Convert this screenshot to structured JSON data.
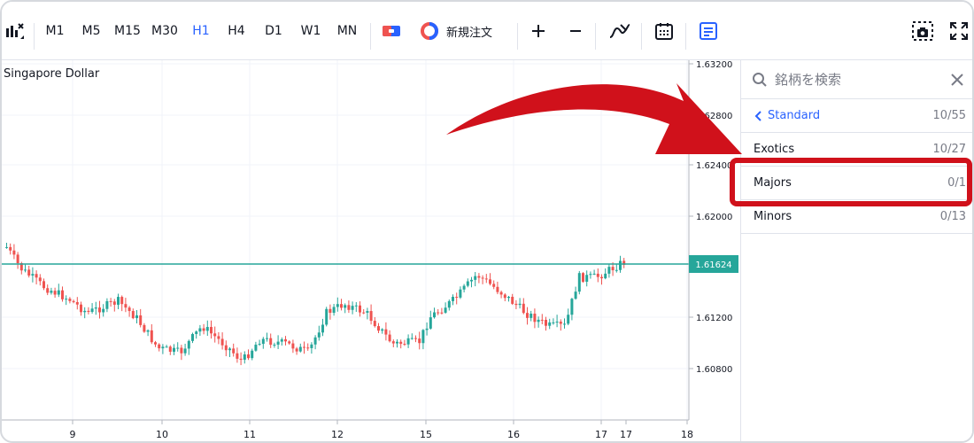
{
  "toolbar": {
    "timeframes": [
      "M1",
      "M5",
      "M15",
      "M30",
      "H1",
      "H4",
      "D1",
      "W1",
      "MN"
    ],
    "active_timeframe": "H1",
    "new_order_label": "新規注文",
    "accent_color": "#2962ff"
  },
  "chart": {
    "symbol_title": "Singapore Dollar",
    "current_price": "1.61624",
    "price_labels": [
      "1.63200",
      "1.62800",
      "1.62400",
      "1.62000",
      "1.61200",
      "1.60800"
    ],
    "date_labels": [
      "9",
      "10",
      "11",
      "12",
      "15",
      "16",
      "17",
      "17",
      "18"
    ],
    "up_color": "#26a69a",
    "down_color": "#ef5350"
  },
  "panel": {
    "search_placeholder": "銘柄を検索",
    "standard": {
      "label": "Standard",
      "count": "10/55"
    },
    "categories": [
      {
        "label": "Exotics",
        "count": "10/27"
      },
      {
        "label": "Majors",
        "count": "0/1"
      },
      {
        "label": "Minors",
        "count": "0/13"
      }
    ]
  },
  "annotation": {
    "color": "#d0111b"
  }
}
